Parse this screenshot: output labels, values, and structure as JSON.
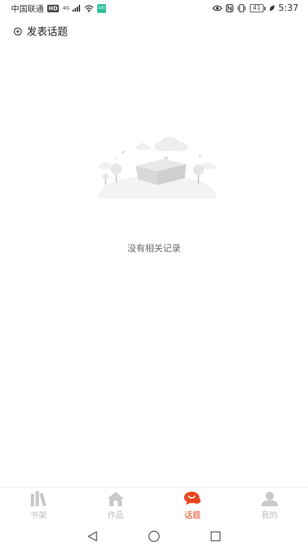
{
  "status_bar": {
    "carrier": "中国联通",
    "hd_badge": "HD",
    "network_type": "4G",
    "app_badge": "GKY",
    "battery": "41",
    "time": "5:37",
    "icons": [
      "signal-icon",
      "wifi-icon",
      "eye-icon",
      "nfc-icon",
      "vibrate-icon",
      "battery-icon",
      "leaf-icon"
    ]
  },
  "header": {
    "post_topic_label": "发表话题",
    "post_topic_icon": "plus-circle-icon"
  },
  "empty_state": {
    "illustration": "empty-house-landscape",
    "message": "没有相关记录"
  },
  "bottom_nav": {
    "active_color": "#e8461f",
    "inactive_color": "#bdbdbd",
    "tabs": [
      {
        "label": "书架",
        "icon": "bookshelf-icon",
        "active": false
      },
      {
        "label": "作品",
        "icon": "home-icon",
        "active": false
      },
      {
        "label": "话题",
        "icon": "chat-bubble-icon",
        "active": true
      },
      {
        "label": "我的",
        "icon": "user-icon",
        "active": false
      }
    ]
  },
  "system_nav": {
    "buttons": [
      "back-icon",
      "home-circle-icon",
      "recents-icon"
    ]
  }
}
